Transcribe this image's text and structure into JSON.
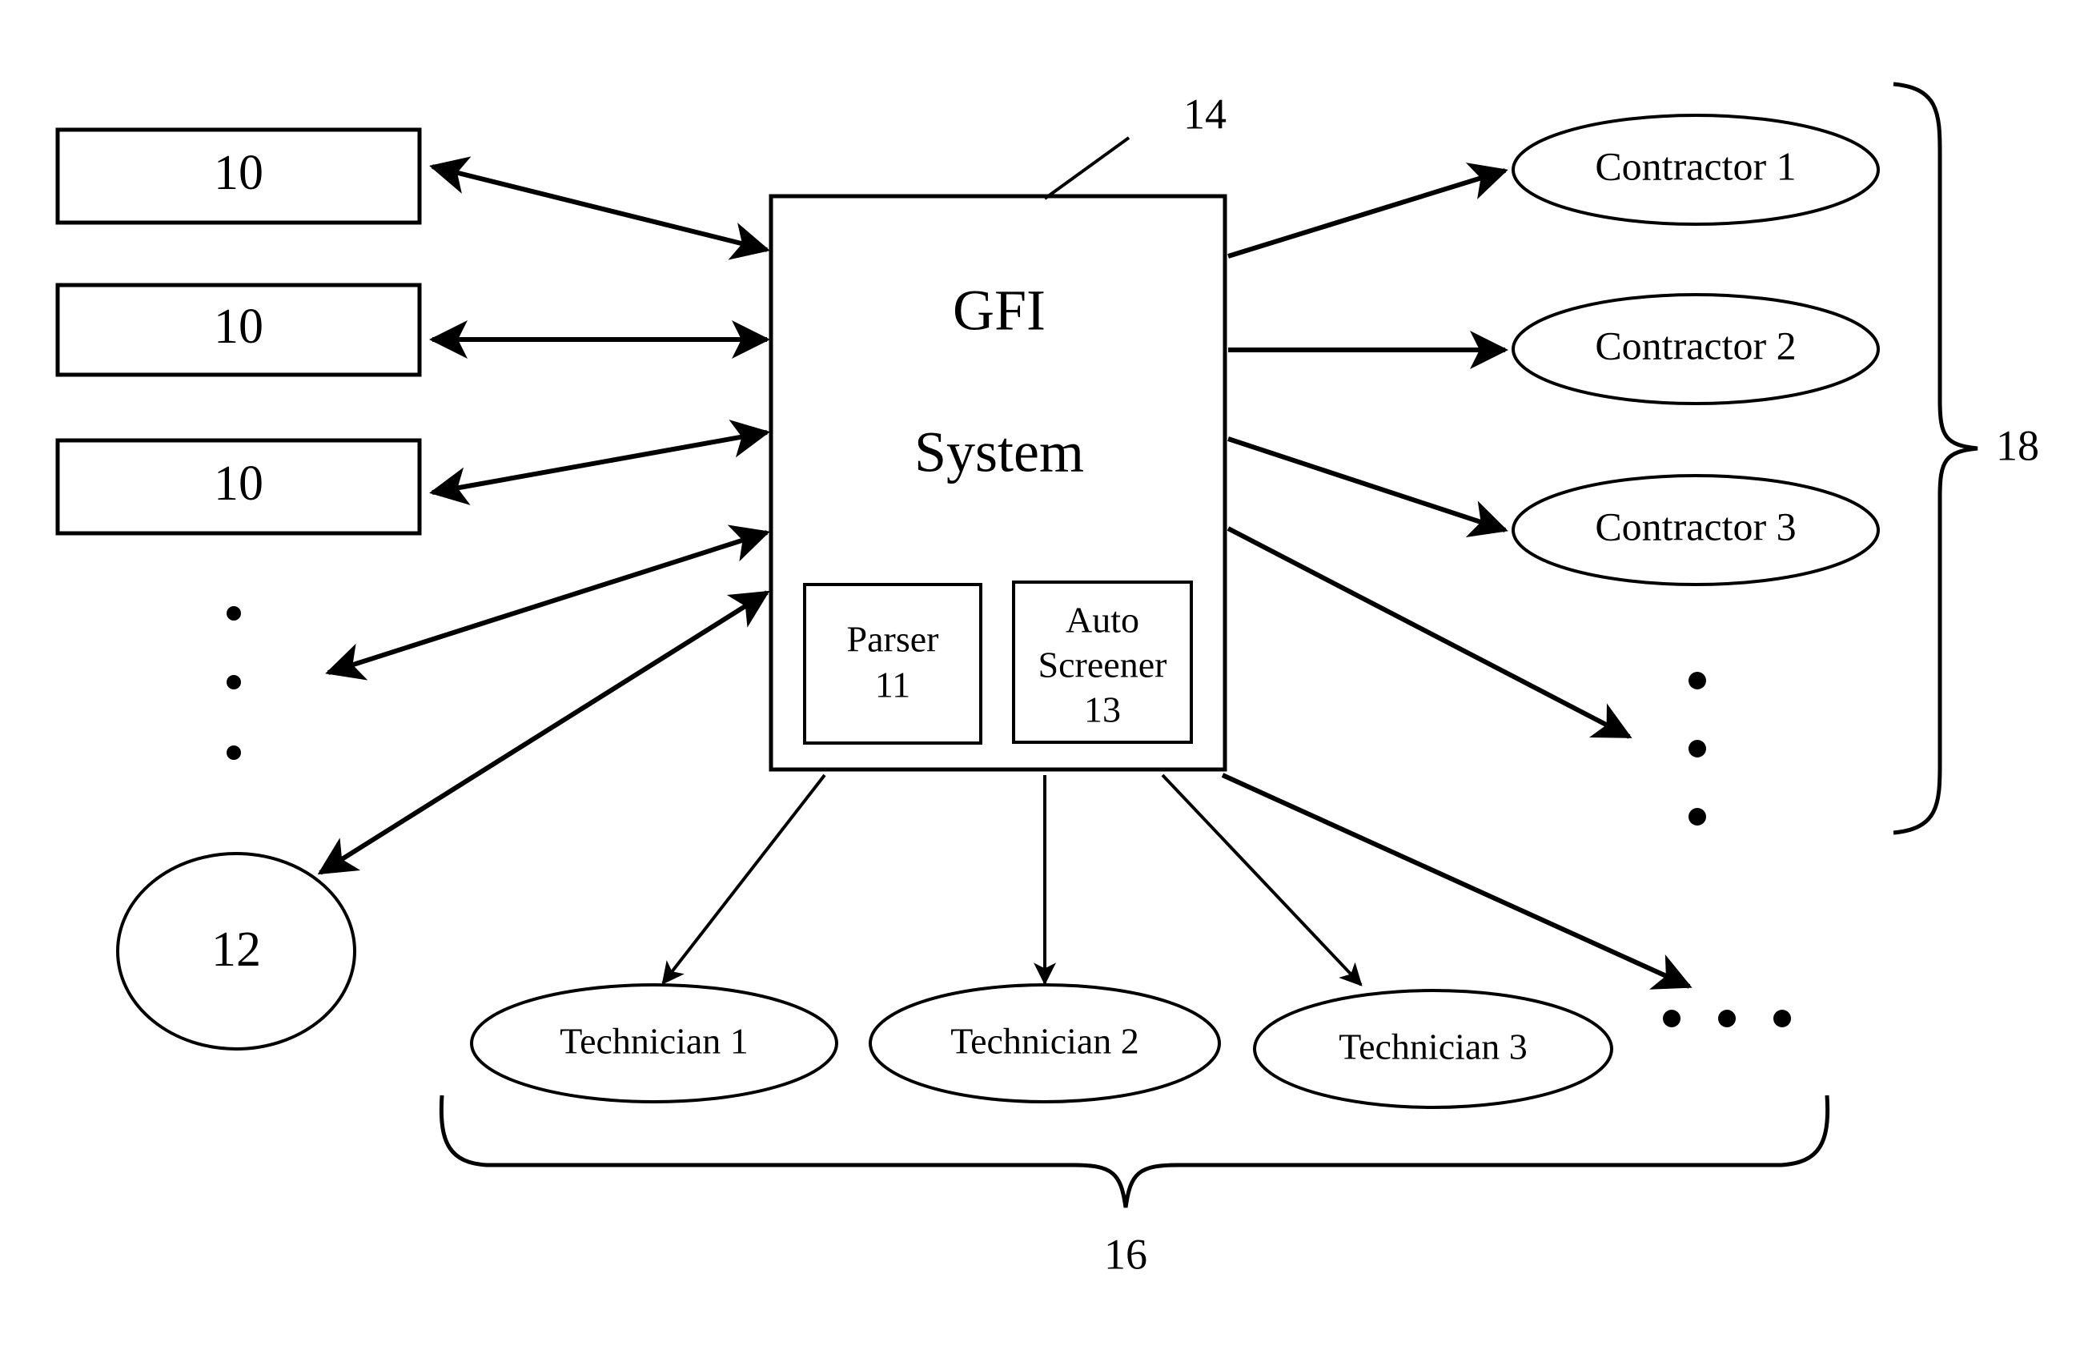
{
  "figure": {
    "type": "patent-block-diagram",
    "background_color": "#ffffff",
    "line_color": "#000000"
  },
  "left_boxes": [
    {
      "label": "10"
    },
    {
      "label": "10"
    },
    {
      "label": "10"
    }
  ],
  "left_circle": {
    "label": "12"
  },
  "left_vertical_ellipsis": {
    "dots": 3
  },
  "center": {
    "title_line1": "GFI",
    "title_line2": "System",
    "reference": "14",
    "subblocks": [
      {
        "name_line1": "Parser",
        "name_line2": "",
        "reference": "11"
      },
      {
        "name_line1": "Auto",
        "name_line2": "Screener",
        "reference": "13"
      }
    ]
  },
  "contractors": {
    "items": [
      {
        "label": "Contractor 1"
      },
      {
        "label": "Contractor 2"
      },
      {
        "label": "Contractor 3"
      }
    ],
    "vertical_ellipsis": {
      "dots": 3
    },
    "brace_reference": "18"
  },
  "technicians": {
    "items": [
      {
        "label": "Technician 1"
      },
      {
        "label": "Technician 2"
      },
      {
        "label": "Technician 3"
      }
    ],
    "horizontal_ellipsis": {
      "dots": 3
    },
    "brace_reference": "16"
  }
}
